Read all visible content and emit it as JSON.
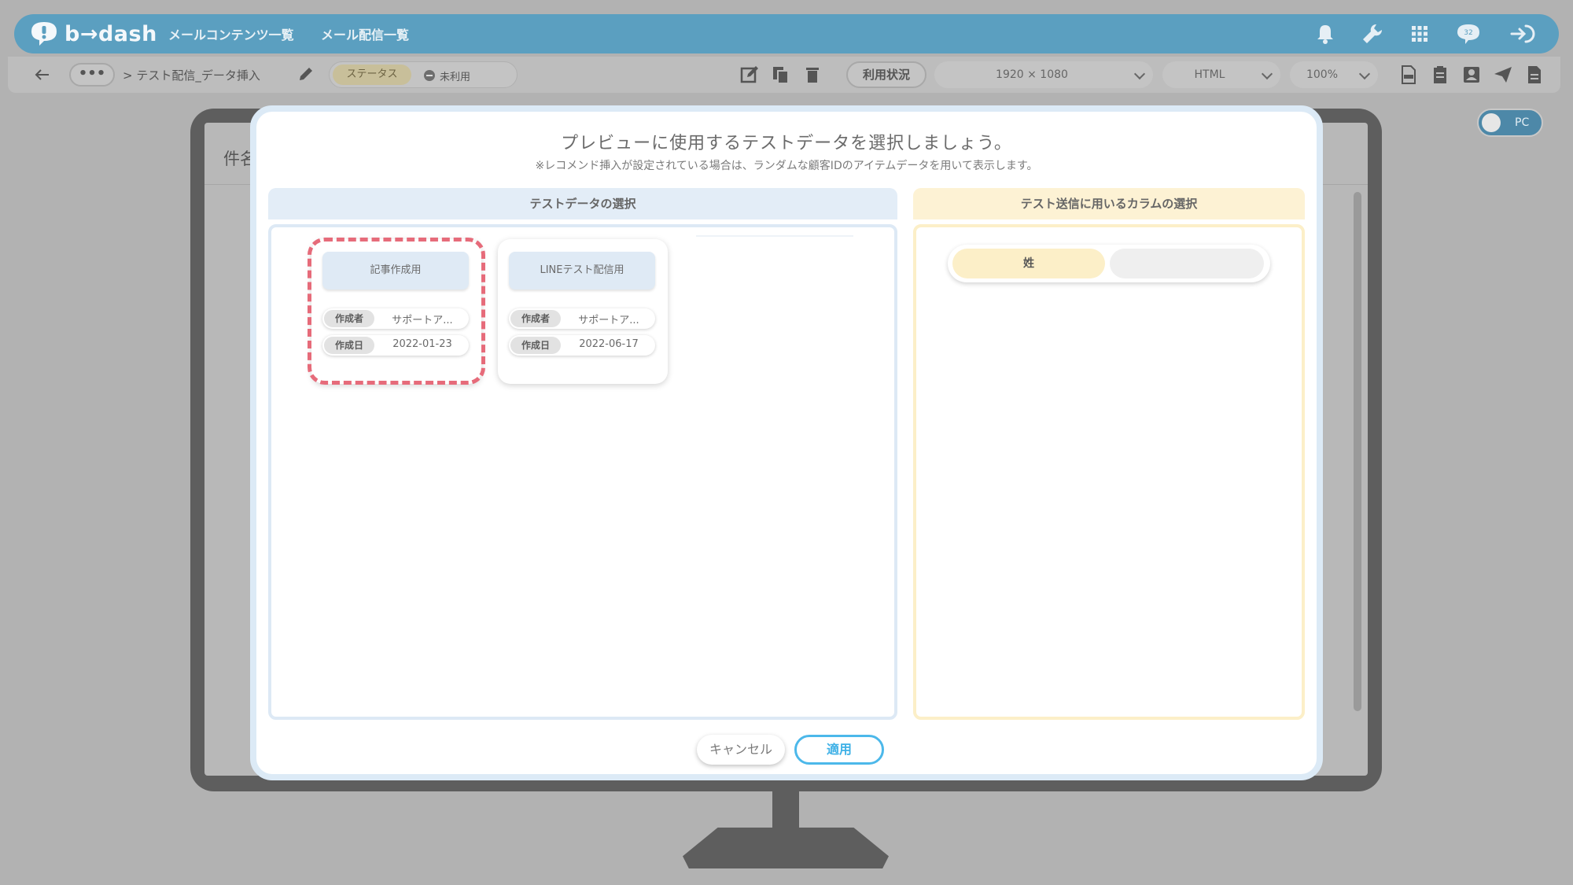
{
  "app": {
    "logo_text": "b→dash",
    "nav": [
      "メールコンテンツ一覧",
      "メール配信一覧"
    ],
    "notification_count": "32"
  },
  "toolbar": {
    "more_label": "•••",
    "breadcrumb": "> テスト配信_データ挿入",
    "status_label": "ステータス",
    "status_value": "未利用",
    "usage_label": "利用状況",
    "resolution": "1920 × 1080",
    "format": "HTML",
    "zoom": "100%"
  },
  "preview": {
    "subject_label": "件名",
    "device_toggle": "PC"
  },
  "modal": {
    "title": "プレビューに使用するテストデータを選択しましょう。",
    "subtitle": "※レコメンド挿入が設定されている場合は、ランダムな顧客IDのアイテムデータを用いて表示します。",
    "left_panel_title": "テストデータの選択",
    "right_panel_title": "テスト送信に用いるカラムの選択",
    "cards": [
      {
        "title": "記事作成用",
        "author_key": "作成者",
        "author_val": "サポートア...",
        "date_key": "作成日",
        "date_val": "2022-01-23",
        "selected": true
      },
      {
        "title": "LINEテスト配信用",
        "author_key": "作成者",
        "author_val": "サポートア...",
        "date_key": "作成日",
        "date_val": "2022-06-17",
        "selected": false
      }
    ],
    "columns": [
      "姓"
    ],
    "cancel_label": "キャンセル",
    "apply_label": "適用"
  },
  "colors": {
    "topbar": "#5b9fc0",
    "selected_outline": "#e66b7a",
    "apply_accent": "#4cb8ea",
    "left_panel": "#e3edf7",
    "right_panel": "#fdf2d4"
  }
}
